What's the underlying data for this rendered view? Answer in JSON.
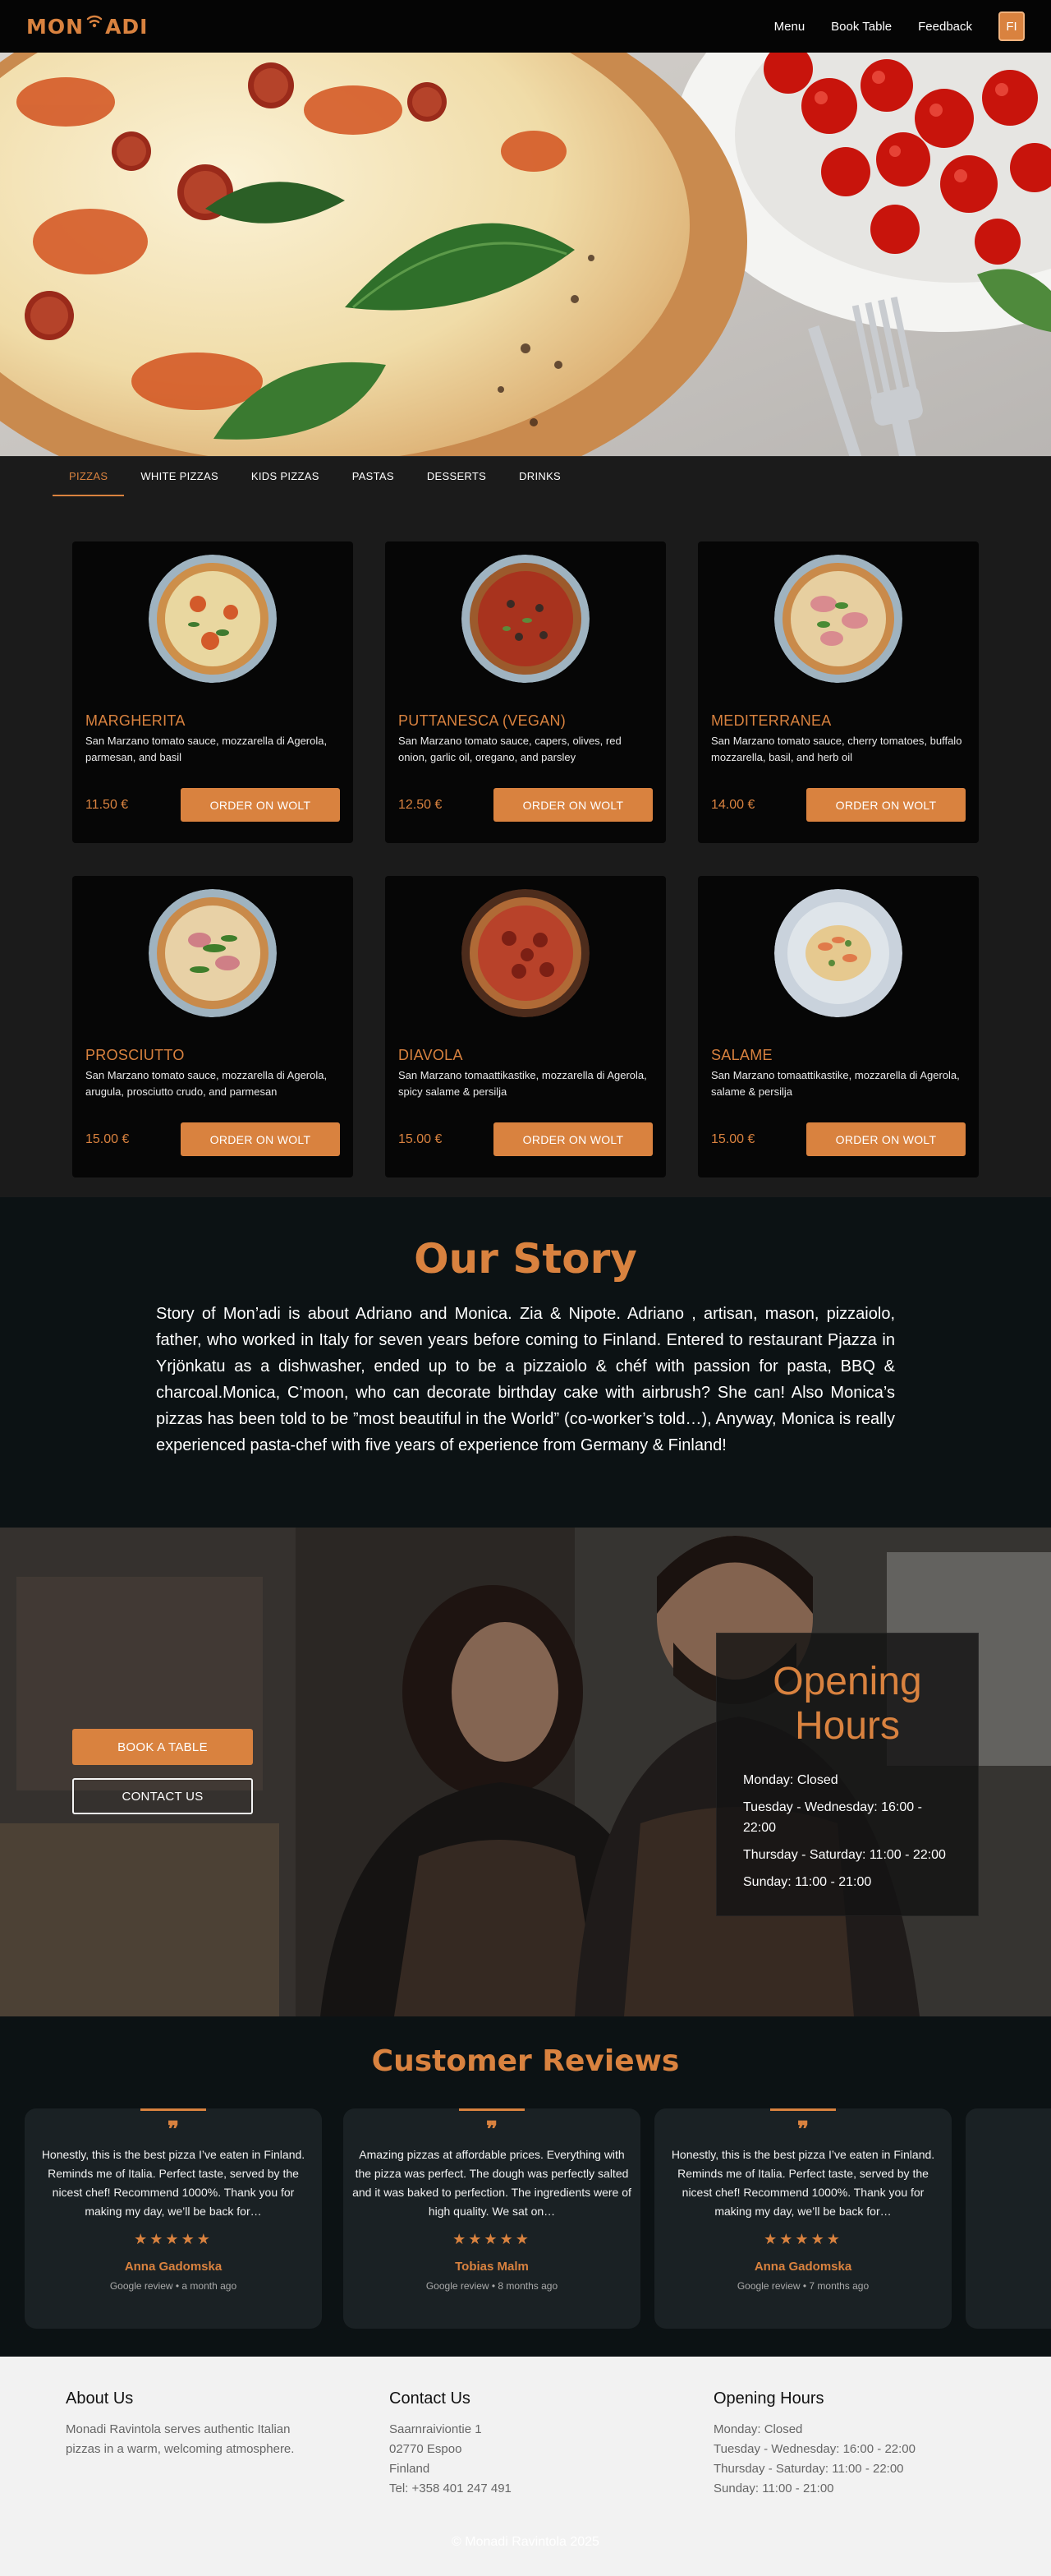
{
  "nav": {
    "logo_left": "MON",
    "logo_right": "ADI",
    "links": [
      "Menu",
      "Book Table",
      "Feedback"
    ],
    "lang": "FI"
  },
  "colors": {
    "accent": "#d9823f",
    "dark": "#0c1214",
    "card": "#060606",
    "menu_bg": "#1b1b1b"
  },
  "tabs": [
    "PIZZAS",
    "WHITE PIZZAS",
    "KIDS PIZZAS",
    "PASTAS",
    "DESSERTS",
    "DRINKS"
  ],
  "menu": {
    "items": [
      {
        "name": "MARGHERITA",
        "desc": "San Marzano tomato sauce, mozzarella di Agerola, parmesan, and basil",
        "price": "11.50 €",
        "button": "ORDER ON WOLT"
      },
      {
        "name": "PUTTANESCA (VEGAN)",
        "desc": "San Marzano tomato sauce, capers, olives, red onion, garlic oil, oregano, and parsley",
        "price": "12.50 €",
        "button": "ORDER ON WOLT"
      },
      {
        "name": "MEDITERRANEA",
        "desc": "San Marzano tomato sauce, cherry tomatoes, buffalo mozzarella, basil, and herb oil",
        "price": "14.00 €",
        "button": "ORDER ON WOLT"
      },
      {
        "name": "PROSCIUTTO",
        "desc": "San Marzano tomato sauce, mozzarella di Agerola, arugula, prosciutto crudo, and parmesan",
        "price": "15.00 €",
        "button": "ORDER ON WOLT"
      },
      {
        "name": "DIAVOLA",
        "desc": "San Marzano tomaattikastike, mozzarella di Agerola, spicy salame & persilja",
        "price": "15.00 €",
        "button": "ORDER ON WOLT"
      },
      {
        "name": "SALAME",
        "desc": "San Marzano tomaattikastike, mozzarella di Agerola, salame & persilja",
        "price": "15.00 €",
        "button": "ORDER ON WOLT"
      }
    ]
  },
  "story": {
    "title": "Our Story",
    "text": "Story of Mon’adi is about Adriano and Monica. Zia & Nipote. Adriano , artisan, mason, pizzaiolo, father, who worked in Italy for seven years before coming to Finland. Entered to restaurant Pjazza in Yrjönkatu as a dishwasher, ended up to be a pizzaiolo & chéf with passion for pasta, BBQ & charcoal.Monica, C’moon, who can decorate birthday cake with airbrush? She can! Also Monica’s pizzas has been told to be ”most beautiful in the World” (co-worker’s told…), Anyway, Monica is really experienced pasta-chef with five years of experience from Germany & Finland!"
  },
  "cta": {
    "book": "BOOK A TABLE",
    "contact": "CONTACT US"
  },
  "hours": {
    "title": "Opening Hours",
    "lines": [
      "Monday: Closed",
      "Tuesday - Wednesday: 16:00 - 22:00",
      "Thursday - Saturday: 11:00 - 22:00",
      "Sunday: 11:00 - 21:00"
    ]
  },
  "reviews": {
    "title": "Customer Reviews",
    "items": [
      {
        "text": "Honestly, this is the best pizza I’ve eaten in Finland. Reminds me of Italia. Perfect taste, served by the nicest chef! Recommend 1000%. Thank you for making my day, we’ll be back for…",
        "stars": "★★★★★",
        "author": "Anna Gadomska",
        "source": "Google review • a month ago"
      },
      {
        "text": "Amazing pizzas at affordable prices. Everything with the pizza was perfect. The dough was perfectly salted and it was baked to perfection. The ingredients were of high quality. We sat on…",
        "stars": "★★★★★",
        "author": "Tobias Malm",
        "source": "Google review • 8 months ago"
      },
      {
        "text": "Honestly, this is the best pizza I’ve eaten in Finland. Reminds me of Italia. Perfect taste, served by the nicest chef! Recommend 1000%. Thank you for making my day, we’ll be back for…",
        "stars": "★★★★★",
        "author": "Anna Gadomska",
        "source": "Google review • 7 months ago"
      }
    ]
  },
  "footer": {
    "about": {
      "title": "About Us",
      "text": "Monadi Ravintola serves authentic Italian pizzas in a warm, welcoming atmosphere."
    },
    "contact": {
      "title": "Contact Us",
      "lines": [
        "Saarnraiviontie 1",
        "02770 Espoo",
        "Finland",
        "Tel: +358 401 247 491"
      ]
    },
    "hours": {
      "title": "Opening Hours",
      "lines": [
        "Monday: Closed",
        "Tuesday - Wednesday: 16:00 - 22:00",
        "Thursday - Saturday: 11:00 - 22:00",
        "Sunday: 11:00 - 21:00"
      ]
    },
    "copyright": "© Monadi Ravintola 2025"
  }
}
